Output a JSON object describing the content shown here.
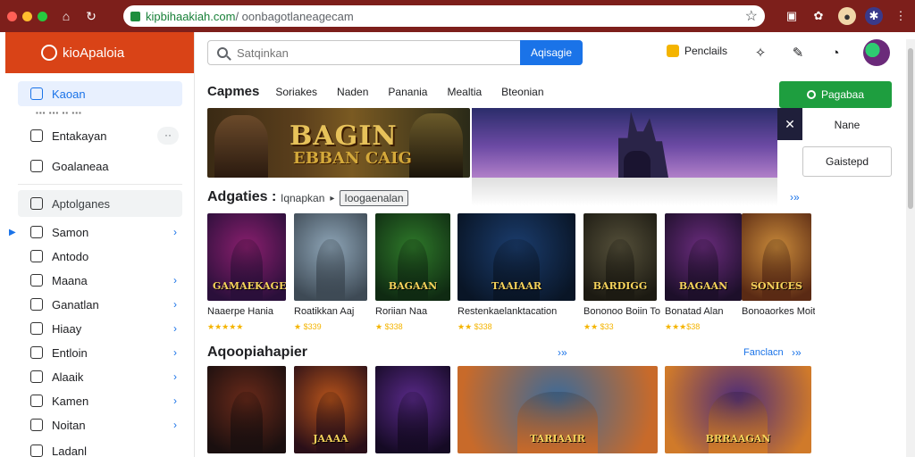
{
  "browser": {
    "url_host": "kipbihaakiah.com",
    "url_path": " / oonbagotlaneagecam",
    "light_colors": [
      "#ff5f56",
      "#ffbd2e",
      "#27c93f"
    ]
  },
  "sidebar": {
    "brand": "kioApaloia",
    "items": [
      {
        "label": "Kaoan",
        "icon": "calendar-icon"
      },
      {
        "label": "Entakayan",
        "icon": "flag-icon"
      },
      {
        "label": "Goalaneaa",
        "icon": "square-icon"
      },
      {
        "label": "Aptolganes",
        "icon": "chat-icon"
      },
      {
        "label": "Samon",
        "icon": "mail-icon"
      },
      {
        "label": "Antodo",
        "icon": "bookmark-icon"
      },
      {
        "label": "Maana",
        "icon": "tag-icon"
      },
      {
        "label": "Ganatlan",
        "icon": "box-icon"
      },
      {
        "label": "Hiaay",
        "icon": "gift-icon"
      },
      {
        "label": "Entloin",
        "icon": "gear-icon"
      },
      {
        "label": "Alaaik",
        "icon": "bell-icon"
      },
      {
        "label": "Kamen",
        "icon": "list-icon"
      },
      {
        "label": "Noitan",
        "icon": "people-icon"
      },
      {
        "label": "Ladanl",
        "icon": "leaf-icon"
      }
    ],
    "more": "··"
  },
  "topbar": {
    "search_placeholder": "Satqinkan",
    "search_button": "Aqisagie",
    "points": "Penclails"
  },
  "tabs": [
    "Capmes",
    "Soriakes",
    "Naden",
    "Panania",
    "Mealtia",
    "Bteonian"
  ],
  "right_panel": {
    "green_button": "Pagabaa",
    "name": "Nane",
    "select": "Gaistepd"
  },
  "hero": {
    "title": "BAGIN",
    "subtitle": "EBBAN CAIG"
  },
  "section1": {
    "title": "Adgaties",
    "crumb1": "Iqnapkan",
    "crumb2": "Ioogaenalan",
    "more_arrow": "›»"
  },
  "section2": {
    "title": "Aqoopiahapier",
    "link": "Fanclacn",
    "more_arrow": "›»"
  },
  "row1": [
    {
      "logo": "GAMAEKAGE",
      "title": "Naaerpe Hania",
      "rating": "★★★★★",
      "art": [
        "#8a1f6e",
        "#2a0f3a"
      ]
    },
    {
      "logo": "",
      "title": "Roatikkan Aaj",
      "rating": "★ $339",
      "art": [
        "#8fa6b8",
        "#3e4a55"
      ]
    },
    {
      "logo": "BAGAAN",
      "title": "Roriian Naa",
      "rating": "★ $338",
      "art": [
        "#2f7a2a",
        "#0f2a12"
      ]
    },
    {
      "logo": "TAAIAAR",
      "title": "Restenkaelanktacation",
      "rating": "★★ $338",
      "art": [
        "#1b3d6e",
        "#091526"
      ]
    },
    {
      "logo": "BARDIGG",
      "title": "Bononoo Boiin Toiin",
      "rating": "★★ $33",
      "art": [
        "#55503a",
        "#1c1a12"
      ]
    },
    {
      "logo": "BAGAAN",
      "title": "Bonatad Alan",
      "rating": "★★★$38",
      "art": [
        "#6a2c7d",
        "#1d0f2a"
      ]
    },
    {
      "logo": "SONICES",
      "title": "Bonoaorkes Moiting Bogoat",
      "rating": "",
      "art": [
        "#c98a3a",
        "#5a2a14"
      ]
    }
  ],
  "row2": [
    {
      "logo": "",
      "art": [
        "#6a2a1a",
        "#1a0f0f"
      ]
    },
    {
      "logo": "JAAAA",
      "art": [
        "#b8541a",
        "#2a0f18"
      ]
    },
    {
      "logo": "",
      "art": [
        "#5a2a8a",
        "#150a24"
      ]
    },
    {
      "logo": "TARIAAIR",
      "art": [
        "#3a6a9a",
        "#c86a2a"
      ]
    },
    {
      "logo": "BRRAAGAN",
      "art": [
        "#4a2a7a",
        "#d07a2a"
      ]
    }
  ],
  "colors": {
    "brand": "#d94317",
    "accent": "#1a73e8",
    "green": "#1e9e3f",
    "chrome": "#7d1f1b"
  }
}
